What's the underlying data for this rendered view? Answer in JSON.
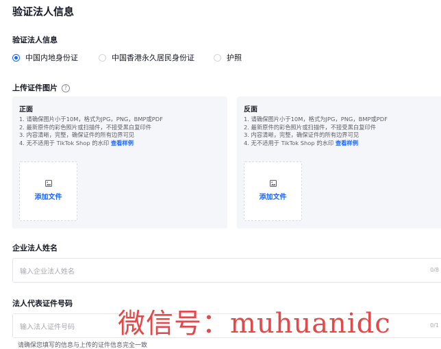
{
  "page_title": "验证法人信息",
  "identity_section": {
    "label": "验证法人信息",
    "options": [
      {
        "label": "中国内地身份证",
        "checked": true
      },
      {
        "label": "中国香港永久居民身份证",
        "checked": false
      },
      {
        "label": "护照",
        "checked": false
      }
    ]
  },
  "upload_section": {
    "label": "上传证件图片",
    "help_icon": "question-circle-icon",
    "front": {
      "title": "正面",
      "rules": [
        "1. 请确保图片小于10M，格式为JPG，PNG，BMP或PDF",
        "2. 最新原件的彩色照片或扫描件，不接受黑白复印件",
        "3. 内容清晰，完整，确保证件的所有边界可见",
        "4. 无不适用于 TikTok Shop 的水印"
      ],
      "sample_link": "查看样例",
      "upload_label": "添加文件",
      "upload_icon": "image-icon"
    },
    "back": {
      "title": "反面",
      "rules": [
        "1. 请确保图片小于10M，格式为JPG，PNG，BMP或PDF",
        "2. 最新原件的彩色照片或扫描件，不接受黑白复印件",
        "3. 内容清晰，完整，确保证件的所有边界可见",
        "4. 无不适用于 TikTok Shop 的水印"
      ],
      "sample_link": "查看样例",
      "upload_label": "添加文件",
      "upload_icon": "image-icon"
    }
  },
  "name_field": {
    "label": "企业法人姓名",
    "placeholder": "输入企业法人姓名",
    "counter": "0/8"
  },
  "id_field": {
    "label": "法人代表证件号码",
    "placeholder": "输入法人证件号码",
    "counter": "0/1",
    "hint": "请确保您填写的信息与上传的证件信息完全一致"
  },
  "watermark": "微信号：muhuanidc",
  "colors": {
    "accent": "#1966ff",
    "watermark": "#e03b3b",
    "panel_bg": "#f5f6f9"
  }
}
